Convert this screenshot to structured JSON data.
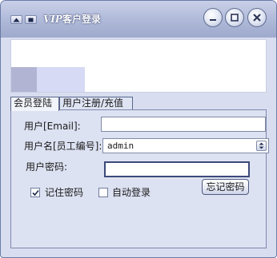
{
  "window": {
    "title_prefix": "VIP",
    "title_suffix": "客户登录"
  },
  "tabs": [
    "会员登陆",
    "用户注册/充值"
  ],
  "form": {
    "email_label": "用户[Email]:",
    "email_value": "",
    "username_label": "用户名[员工编号]:",
    "username_value": "admin",
    "password_label": "用户密码:",
    "password_value": "",
    "forgot_button": "忘记密码",
    "remember_label": "记住密码",
    "remember_checked": true,
    "autologin_label": "自动登录",
    "autologin_checked": false
  },
  "icons": {
    "titlebar_left": [
      "up-arrow-icon",
      "restore-icon"
    ],
    "titlebar_right": [
      "minimize-icon",
      "maximize-icon",
      "close-icon"
    ],
    "combo": "chevron-up-down-icon",
    "check": "checkmark-icon"
  },
  "colors": {
    "titlebar": "#aeb8d8",
    "panel": "#dde2f2",
    "window": "#d8def0"
  }
}
